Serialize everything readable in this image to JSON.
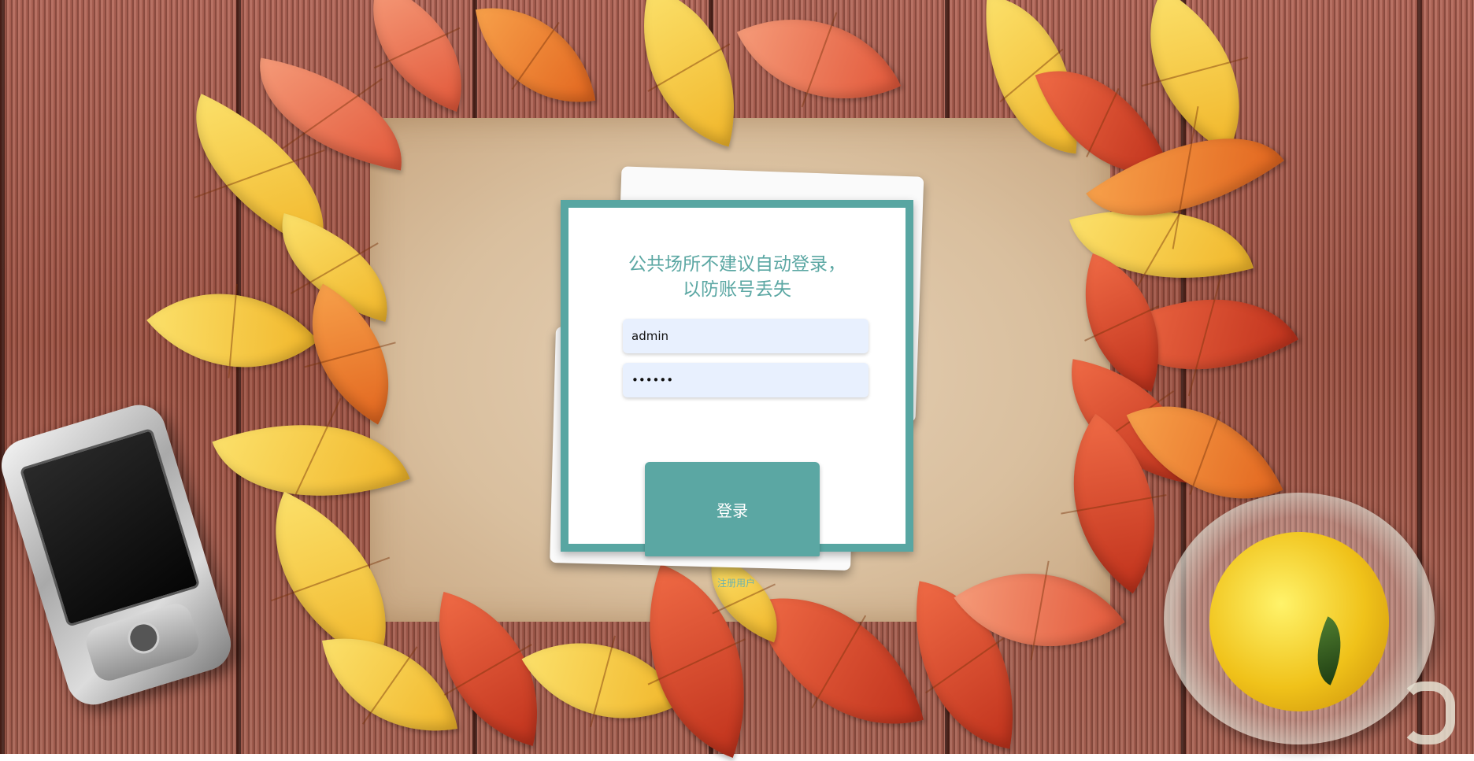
{
  "login": {
    "notice_line1": "公共场所不建议自动登录，",
    "notice_line2": "以防账号丢失",
    "username_value": "admin",
    "password_value": "••••••",
    "submit_label": "登录",
    "register_label": "注册用户"
  },
  "theme": {
    "accent": "#5ba7a3",
    "card_border": "#58a6a2",
    "input_background": "#e8f0fe"
  },
  "decor": {
    "background": "autumn-leaves-on-wood",
    "phone": "mobile-phone-image",
    "cup": "tea-cup-image"
  }
}
